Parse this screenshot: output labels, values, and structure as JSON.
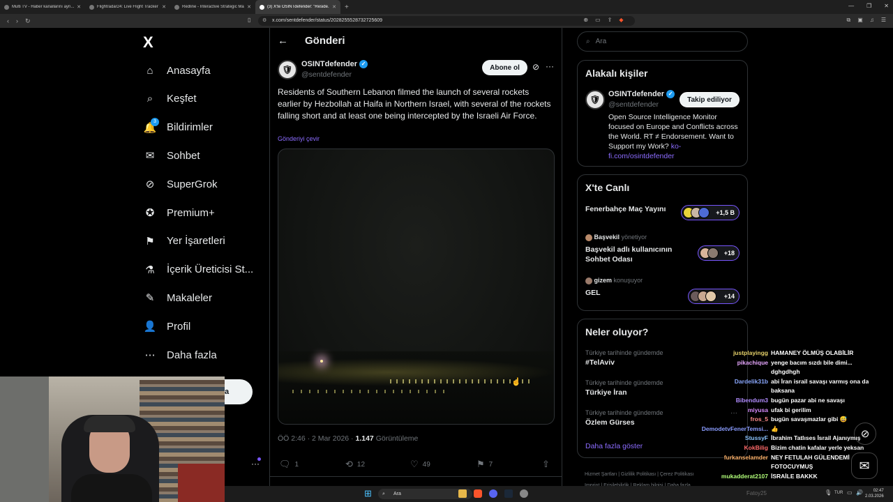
{
  "browser": {
    "tabs": [
      {
        "title": "Multi TV - Haber kanallarını ayrı..."
      },
      {
        "title": "Flightradar24: Live Flight Tracker - R..."
      },
      {
        "title": "Redline - Interactive Strategic Map"
      },
      {
        "title": "(3) X'te OSINTdefender: \"Reside...",
        "active": true
      }
    ],
    "url": "x.com/sentdefender/status/2028255528732725609"
  },
  "sidebar": {
    "logo": "X",
    "items": [
      {
        "label": "Anasayfa",
        "icon": "home-icon"
      },
      {
        "label": "Keşfet",
        "icon": "search-icon"
      },
      {
        "label": "Bildirimler",
        "icon": "bell-icon",
        "badge": "3"
      },
      {
        "label": "Sohbet",
        "icon": "mail-icon"
      },
      {
        "label": "SuperGrok",
        "icon": "grok-icon"
      },
      {
        "label": "Premium+",
        "icon": "verified-icon"
      },
      {
        "label": "Yer İşaretleri",
        "icon": "bookmark-icon"
      },
      {
        "label": "İçerik Üreticisi St...",
        "icon": "flask-icon"
      },
      {
        "label": "Makaleler",
        "icon": "article-icon"
      },
      {
        "label": "Profil",
        "icon": "person-icon"
      },
      {
        "label": "Daha fazla",
        "icon": "more-circle-icon"
      }
    ],
    "post_button_fragment": "a"
  },
  "post": {
    "header_title": "Gönderi",
    "author_name": "OSINTdefender",
    "author_handle": "@sentdefender",
    "subscribe_label": "Abone ol",
    "text": "Residents of Southern Lebanon filmed the launch of several rockets earlier by Hezbollah at Haifa in Northern Israel, with several of the rockets falling short and at least one being intercepted by the Israeli Air Force.",
    "translate_label": "Gönderiyi çevir",
    "time": "ÖÖ 2:46 · 2 Mar 2026 ·",
    "views_count": "1.147",
    "views_label": "Görüntüleme",
    "replies": "1",
    "reposts": "12",
    "likes": "49",
    "bookmarks": "7"
  },
  "right": {
    "search_placeholder": "Ara",
    "related": {
      "title": "Alakalı kişiler",
      "name": "OSINTdefender",
      "handle": "@sentdefender",
      "follow_label": "Takip ediliyor",
      "bio": "Open Source Intelligence Monitor focused on Europe and Conflicts across the World. RT ≠ Endorsement. Want to Support my Work?",
      "bio_link": "ko-fi.com/osintdefender"
    },
    "live": {
      "title": "X'te Canlı",
      "items": [
        {
          "host": "",
          "role": "",
          "title": "Fenerbahçe Maç Yayını",
          "count": "+1,5 B"
        },
        {
          "host": "Başvekil",
          "role": "yönetiyor",
          "title": "Başvekil adlı kullanıcının Sohbet Odası",
          "count": "+18"
        },
        {
          "host": "gizem",
          "role": "konuşuyor",
          "title": "GEL",
          "count": "+14"
        }
      ]
    },
    "trends": {
      "title": "Neler oluyor?",
      "items": [
        {
          "context": "Türkiye tarihinde gündemde",
          "name": "#TelAviv"
        },
        {
          "context": "Türkiye tarihinde gündemde",
          "name": "Türkiye İran"
        },
        {
          "context": "Türkiye tarihinde gündemde",
          "name": "Özlem Gürses"
        }
      ],
      "more_label": "Daha fazla göster"
    },
    "footer": [
      "Hizmet Şartları",
      "Gizlilik Politikası",
      "Çerez Politikası",
      "Imprint",
      "Erişilebilirlik",
      "Reklam bilgisi",
      "Daha fazla ..."
    ]
  },
  "chat": [
    {
      "user": "justplayingg",
      "color": "#e6d26a",
      "msg": "HAMANEY ÖLMÜŞ OLABİLİR"
    },
    {
      "user": "pikachique",
      "color": "#e7a7ff",
      "msg": "yenge bacım sızdı bile dimi..."
    },
    {
      "user": "",
      "color": "#ffffff",
      "msg": "dghgdhgh"
    },
    {
      "user": "Dardelik31b",
      "color": "#8aa8ff",
      "msg": "abi İran israil savaşı varmış ona da"
    },
    {
      "user": "",
      "color": "#ffffff",
      "msg": "baksana"
    },
    {
      "user": "Bibendum3",
      "color": "#b18cff",
      "msg": "bugün pazar abi ne savaşı"
    },
    {
      "user": "miyusa",
      "color": "#d88cff",
      "msg": "ufak bi gerilim"
    },
    {
      "user": "fros_5",
      "color": "#ff8c8c",
      "msg": "bugün savaşmazlar gibi 😅"
    },
    {
      "user": "DemodetvFenerTemsi...",
      "color": "#8a9cff",
      "msg": "👍"
    },
    {
      "user": "StussyF",
      "color": "#8cc4ff",
      "msg": "İbrahim Tatlıses İsrail Ajanıymış"
    },
    {
      "user": "KokBilig",
      "color": "#ff6a6a",
      "msg": "Bizim chatin kafalar yerle yeksan"
    },
    {
      "user": "furkanselamder",
      "color": "#ffb36b",
      "msg": "NEY FETULAH GÜLENDEMİ"
    },
    {
      "user": "",
      "color": "#ffffff",
      "msg": "FOTOCUYMUŞ"
    },
    {
      "user": "mukadderat2107",
      "color": "#b2ff7a",
      "msg": "İSRAİLE BAKKK"
    }
  ],
  "taskbar": {
    "search_placeholder": "Ara",
    "user": "Fatoy25",
    "lang": "TUR",
    "time": "02:47",
    "date": "2.03.2026"
  }
}
